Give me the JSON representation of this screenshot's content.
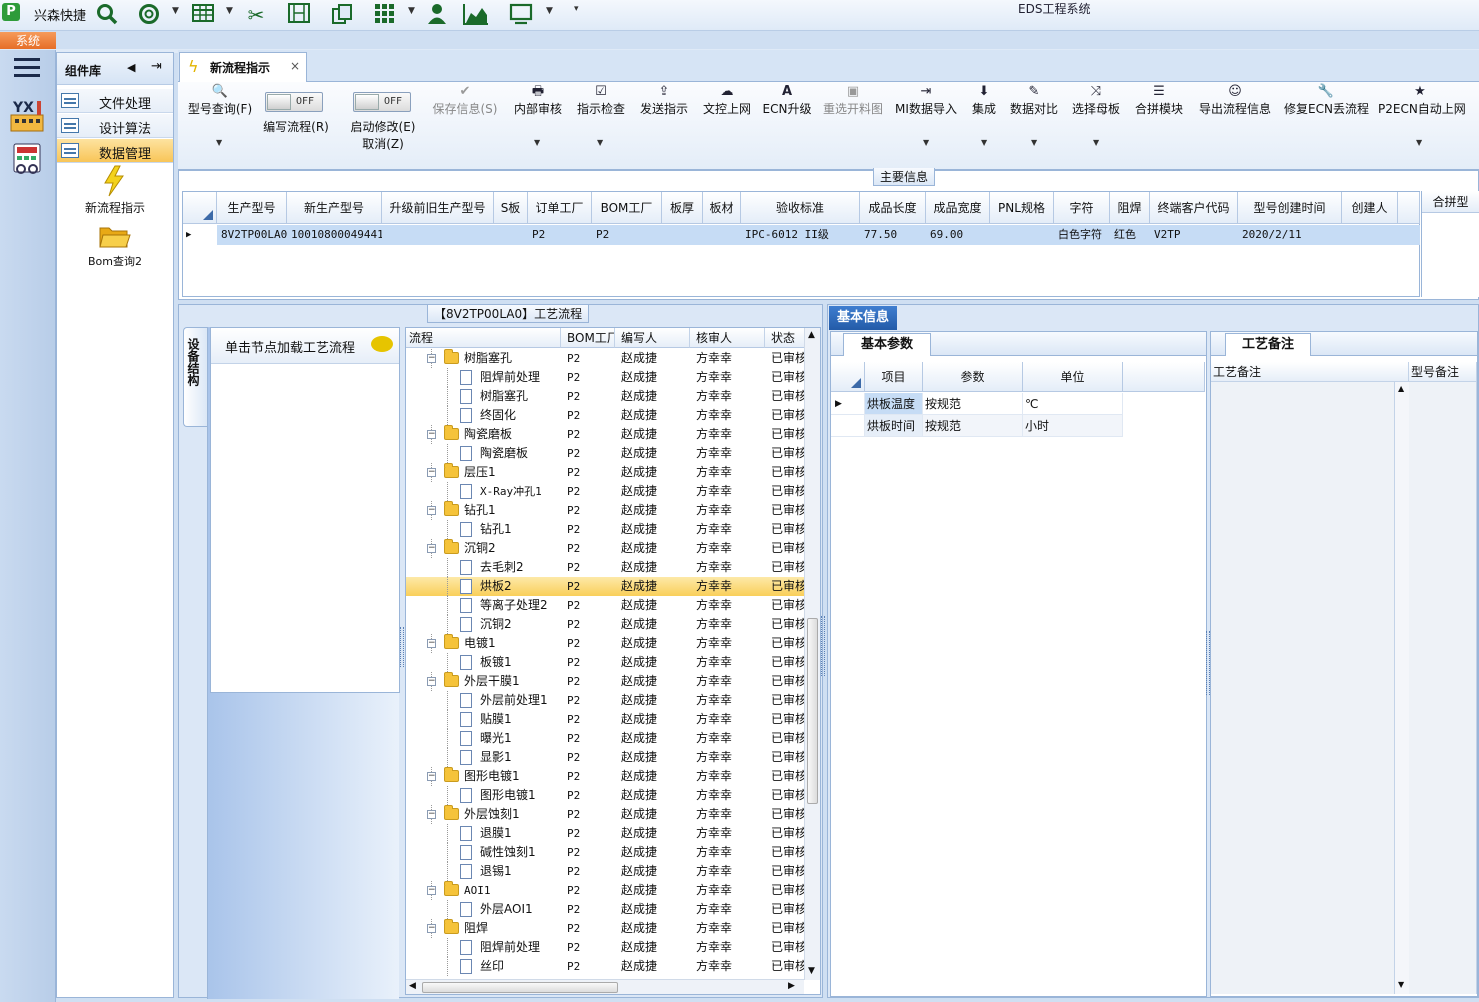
{
  "app": {
    "title": "EDS工程系统",
    "quick_title": "兴森快捷",
    "logo_text": "P",
    "system_tab": "系统"
  },
  "quick_icons": [
    "search-icon",
    "lifebuoy-icon",
    "table-icon",
    "scissors-icon",
    "film-icon",
    "copy-icon",
    "grid-icon",
    "user-icon",
    "chart-icon",
    "monitor-icon"
  ],
  "sidebar": {
    "title": "组件库",
    "items": [
      {
        "label": "文件处理"
      },
      {
        "label": "设计算法"
      },
      {
        "label": "数据管理"
      }
    ],
    "tools": [
      {
        "label": "新流程指示"
      },
      {
        "label": "Bom查询2"
      }
    ],
    "badge_text": "YX"
  },
  "doc_tab": {
    "label": "新流程指示",
    "close": "×"
  },
  "ribbon": {
    "toggle_text": "OFF",
    "buttons": [
      {
        "icon": "🔍",
        "label": "型号查询(F)"
      },
      {
        "label": "编写流程(R)"
      },
      {
        "label": "启动修改(E)",
        "label2": "取消(Z)"
      },
      {
        "icon": "✔",
        "label": "保存信息(S)"
      },
      {
        "icon": "🖶",
        "label": "内部审核"
      },
      {
        "icon": "☑",
        "label": "指示检查"
      },
      {
        "icon": "⇪",
        "label": "发送指示"
      },
      {
        "icon": "☁",
        "label": "文控上网"
      },
      {
        "icon": "A",
        "label": "ECN升级"
      },
      {
        "icon": "▣",
        "label": "重选开料图"
      },
      {
        "icon": "⇥",
        "label": "MI数据导入"
      },
      {
        "icon": "⬇",
        "label": "集成"
      },
      {
        "icon": "✎",
        "label": "数据对比"
      },
      {
        "icon": "⤨",
        "label": "选择母板"
      },
      {
        "icon": "☰",
        "label": "合拼模块"
      },
      {
        "icon": "☺",
        "label": "导出流程信息"
      },
      {
        "icon": "🔧",
        "label": "修复ECN丢流程"
      },
      {
        "icon": "★",
        "label": "P2ECN自动上网"
      }
    ]
  },
  "main_info": {
    "caption": "主要信息",
    "columns": [
      "生产型号",
      "新生产型号",
      "升级前旧生产型号",
      "S板",
      "订单工厂",
      "BOM工厂",
      "板厚",
      "板材",
      "验收标准",
      "成品长度",
      "成品宽度",
      "PNL规格",
      "字符",
      "阻焊",
      "终端客户代码",
      "型号创建时间",
      "创建人"
    ],
    "row": [
      "8V2TP00LA0",
      "10010800049441",
      "",
      "",
      "P2",
      "P2",
      "",
      "",
      "IPC-6012 II级",
      "77.50",
      "69.00",
      "",
      "白色字符",
      "红色",
      "V2TP",
      "2020/2/11",
      ""
    ],
    "merge_label": "合拼型"
  },
  "process": {
    "caption": "【8V2TP00LA0】工艺流程",
    "vtab": "设备结构",
    "hint": "单击节点加载工艺流程",
    "columns": [
      "流程",
      "BOM工厂",
      "编写人",
      "核审人",
      "状态"
    ],
    "rows": [
      {
        "name": "树脂塞孔",
        "level": 0,
        "factory": "P2",
        "writer": "赵成捷",
        "checker": "方幸幸",
        "status": "已审核"
      },
      {
        "name": "阻焊前处理",
        "level": 1,
        "factory": "P2",
        "writer": "赵成捷",
        "checker": "方幸幸",
        "status": "已审核"
      },
      {
        "name": "树脂塞孔",
        "level": 1,
        "factory": "P2",
        "writer": "赵成捷",
        "checker": "方幸幸",
        "status": "已审核"
      },
      {
        "name": "终固化",
        "level": 1,
        "factory": "P2",
        "writer": "赵成捷",
        "checker": "方幸幸",
        "status": "已审核"
      },
      {
        "name": "陶瓷磨板",
        "level": 0,
        "factory": "P2",
        "writer": "赵成捷",
        "checker": "方幸幸",
        "status": "已审核"
      },
      {
        "name": "陶瓷磨板",
        "level": 1,
        "factory": "P2",
        "writer": "赵成捷",
        "checker": "方幸幸",
        "status": "已审核"
      },
      {
        "name": "层压1",
        "level": 0,
        "factory": "P2",
        "writer": "赵成捷",
        "checker": "方幸幸",
        "status": "已审核"
      },
      {
        "name": "X-Ray冲孔1",
        "level": 1,
        "factory": "P2",
        "writer": "赵成捷",
        "checker": "方幸幸",
        "status": "已审核"
      },
      {
        "name": "钻孔1",
        "level": 0,
        "factory": "P2",
        "writer": "赵成捷",
        "checker": "方幸幸",
        "status": "已审核"
      },
      {
        "name": "钻孔1",
        "level": 1,
        "factory": "P2",
        "writer": "赵成捷",
        "checker": "方幸幸",
        "status": "已审核"
      },
      {
        "name": "沉铜2",
        "level": 0,
        "factory": "P2",
        "writer": "赵成捷",
        "checker": "方幸幸",
        "status": "已审核"
      },
      {
        "name": "去毛刺2",
        "level": 1,
        "factory": "P2",
        "writer": "赵成捷",
        "checker": "方幸幸",
        "status": "已审核"
      },
      {
        "name": "烘板2",
        "level": 1,
        "factory": "P2",
        "writer": "赵成捷",
        "checker": "方幸幸",
        "status": "已审核",
        "selected": true
      },
      {
        "name": "等离子处理2",
        "level": 1,
        "factory": "P2",
        "writer": "赵成捷",
        "checker": "方幸幸",
        "status": "已审核"
      },
      {
        "name": "沉铜2",
        "level": 1,
        "factory": "P2",
        "writer": "赵成捷",
        "checker": "方幸幸",
        "status": "已审核"
      },
      {
        "name": "电镀1",
        "level": 0,
        "factory": "P2",
        "writer": "赵成捷",
        "checker": "方幸幸",
        "status": "已审核"
      },
      {
        "name": "板镀1",
        "level": 1,
        "factory": "P2",
        "writer": "赵成捷",
        "checker": "方幸幸",
        "status": "已审核"
      },
      {
        "name": "外层干膜1",
        "level": 0,
        "factory": "P2",
        "writer": "赵成捷",
        "checker": "方幸幸",
        "status": "已审核"
      },
      {
        "name": "外层前处理1",
        "level": 1,
        "factory": "P2",
        "writer": "赵成捷",
        "checker": "方幸幸",
        "status": "已审核"
      },
      {
        "name": "贴膜1",
        "level": 1,
        "factory": "P2",
        "writer": "赵成捷",
        "checker": "方幸幸",
        "status": "已审核"
      },
      {
        "name": "曝光1",
        "level": 1,
        "factory": "P2",
        "writer": "赵成捷",
        "checker": "方幸幸",
        "status": "已审核"
      },
      {
        "name": "显影1",
        "level": 1,
        "factory": "P2",
        "writer": "赵成捷",
        "checker": "方幸幸",
        "status": "已审核"
      },
      {
        "name": "图形电镀1",
        "level": 0,
        "factory": "P2",
        "writer": "赵成捷",
        "checker": "方幸幸",
        "status": "已审核"
      },
      {
        "name": "图形电镀1",
        "level": 1,
        "factory": "P2",
        "writer": "赵成捷",
        "checker": "方幸幸",
        "status": "已审核"
      },
      {
        "name": "外层蚀刻1",
        "level": 0,
        "factory": "P2",
        "writer": "赵成捷",
        "checker": "方幸幸",
        "status": "已审核"
      },
      {
        "name": "退膜1",
        "level": 1,
        "factory": "P2",
        "writer": "赵成捷",
        "checker": "方幸幸",
        "status": "已审核"
      },
      {
        "name": "碱性蚀刻1",
        "level": 1,
        "factory": "P2",
        "writer": "赵成捷",
        "checker": "方幸幸",
        "status": "已审核"
      },
      {
        "name": "退锡1",
        "level": 1,
        "factory": "P2",
        "writer": "赵成捷",
        "checker": "方幸幸",
        "status": "已审核"
      },
      {
        "name": "AOI1",
        "level": 0,
        "factory": "P2",
        "writer": "赵成捷",
        "checker": "方幸幸",
        "status": "已审核"
      },
      {
        "name": "外层AOI1",
        "level": 1,
        "factory": "P2",
        "writer": "赵成捷",
        "checker": "方幸幸",
        "status": "已审核"
      },
      {
        "name": "阻焊",
        "level": 0,
        "factory": "P2",
        "writer": "赵成捷",
        "checker": "方幸幸",
        "status": "已审核"
      },
      {
        "name": "阻焊前处理",
        "level": 1,
        "factory": "P2",
        "writer": "赵成捷",
        "checker": "方幸幸",
        "status": "已审核"
      },
      {
        "name": "丝印",
        "level": 1,
        "factory": "P2",
        "writer": "赵成捷",
        "checker": "方幸幸",
        "status": "已审核"
      }
    ]
  },
  "basic_info": {
    "tab": "基本信息",
    "params_tab": "基本参数",
    "param_columns": [
      "项目",
      "参数",
      "单位"
    ],
    "params": [
      {
        "item": "烘板温度",
        "value": "按规范",
        "unit": "℃"
      },
      {
        "item": "烘板时间",
        "value": "按规范",
        "unit": "小时"
      }
    ],
    "notes_tab": "工艺备注",
    "note_columns": [
      "工艺备注",
      "型号备注"
    ]
  }
}
